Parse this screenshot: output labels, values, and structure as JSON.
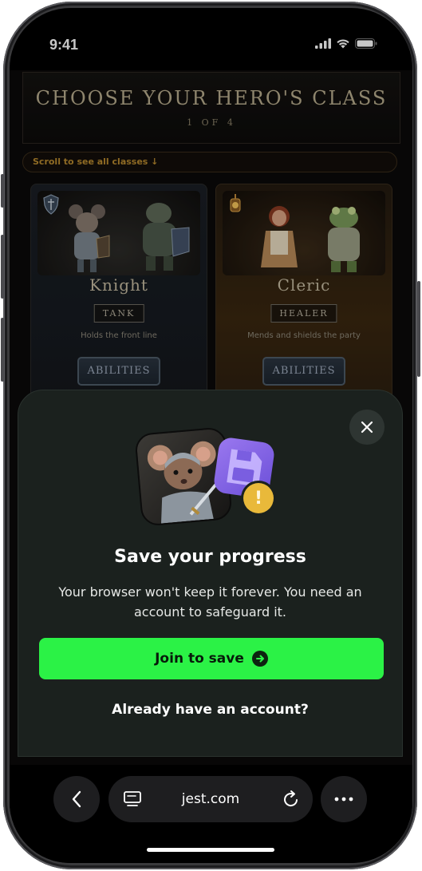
{
  "status_bar": {
    "time": "9:41"
  },
  "game": {
    "title": "CHOOSE YOUR HERO'S CLASS",
    "page_indicator": "1 OF 4",
    "scroll_hint": "Scroll to see all classes ↓",
    "classes": [
      {
        "name": "Knight",
        "role": "TANK",
        "description": "Holds the front line",
        "button": "ABILITIES"
      },
      {
        "name": "Cleric",
        "role": "HEALER",
        "description": "Mends and shields the party",
        "button": "ABILITIES"
      }
    ]
  },
  "modal": {
    "title": "Save your progress",
    "body": "Your browser won't keep it forever. You need an account to safeguard it.",
    "primary_button": "Join to save",
    "secondary_link": "Already have an account?",
    "accent_color": "#2bf246"
  },
  "browser": {
    "url": "jest.com"
  }
}
